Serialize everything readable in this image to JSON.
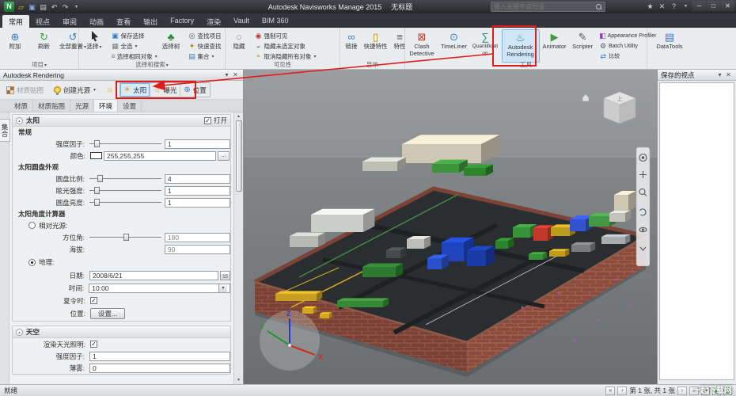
{
  "titlebar": {
    "title": "Autodesk Navisworks Manage 2015",
    "doc_name": "无标题",
    "search_placeholder": "键入关键字或短语"
  },
  "tabs": {
    "items": [
      "常用",
      "视点",
      "审阅",
      "动画",
      "查看",
      "输出",
      "Factory",
      "渲染",
      "Vault",
      "BIM 360"
    ],
    "active": "常用"
  },
  "ribbon": {
    "project": {
      "label": "项目",
      "append": "附加",
      "refresh": "刷新",
      "reset_all": "全部重置"
    },
    "selection": {
      "label": "选择和搜索",
      "select": "选择",
      "save_selection": "保存选择",
      "select_all": "全选",
      "select_same": "选择相同对象",
      "selection_tree": "选择树",
      "find_items": "查找项目",
      "quick_find": "快速查找",
      "sets": "集合"
    },
    "visibility": {
      "label": "可见性",
      "hide": "隐藏",
      "require": "强制可见",
      "hide_unselected": "隐藏未选定对象",
      "unhide_all": "取消隐藏所有对象"
    },
    "display": {
      "label": "显示",
      "links": "链接",
      "quick_properties": "快捷特性",
      "properties": "特性"
    },
    "tools": {
      "label": "工具",
      "clash": "Clash Detective",
      "timeliner": "TimeLiner",
      "quantification": "Quantification",
      "rendering": "Autodesk Rendering",
      "animator": "Animator",
      "scripter": "Scripter",
      "appearance_profiler": "Appearance Profiler",
      "batch_utility": "Batch Utility",
      "compare": "比较"
    },
    "datatools": {
      "label": "DataTools"
    }
  },
  "panel": {
    "title": "Autodesk Rendering",
    "toolbar": {
      "material_mapping": "材质贴图",
      "create_light": "创建光源",
      "sun": "太阳",
      "exposure": "曝光",
      "location": "位置"
    },
    "tabs": [
      "材质",
      "材质贴图",
      "光源",
      "环境",
      "设置"
    ],
    "collapsed_tab": "集合",
    "sun": {
      "header": "太阳",
      "on": "打开",
      "general": "常规",
      "intensity_label": "强度因子:",
      "intensity_value": "1",
      "color_label": "颜色:",
      "color_value": "255,255,255",
      "color_more": "...",
      "disk": "太阳圆盘外观",
      "disk_scale_label": "圆盘比例:",
      "disk_scale_value": "4",
      "glow_label": "眩光强度:",
      "glow_value": "1",
      "brightness_label": "圆盘亮度:",
      "brightness_value": "1",
      "calc": "太阳角度计算器",
      "relative_label": "相对光源:",
      "azimuth_label": "方位角:",
      "azimuth_value": "180",
      "altitude_label": "海拔:",
      "altitude_value": "90",
      "geo_label": "地理:",
      "date_label": "日期:",
      "date_value": "2008/6/21",
      "calendar_day": "15",
      "time_label": "时间:",
      "time_value": "10:00",
      "dst_label": "夏令时:",
      "loc_label": "位置:",
      "loc_button": "设置..."
    },
    "sky": {
      "header": "天空",
      "skylight_label": "渲染天光照明:",
      "intensity_label": "强度因子:",
      "intensity_value": "1",
      "haze_label": "薄雾:",
      "haze_value": "0"
    }
  },
  "viewport": {
    "viewcube_top": "上"
  },
  "saved_viewpoints": {
    "title": "保存的视点"
  },
  "statusbar": {
    "ready": "就绪",
    "sheet_info": "第 1 张, 共 1 张"
  },
  "watermark": "一起下载网"
}
